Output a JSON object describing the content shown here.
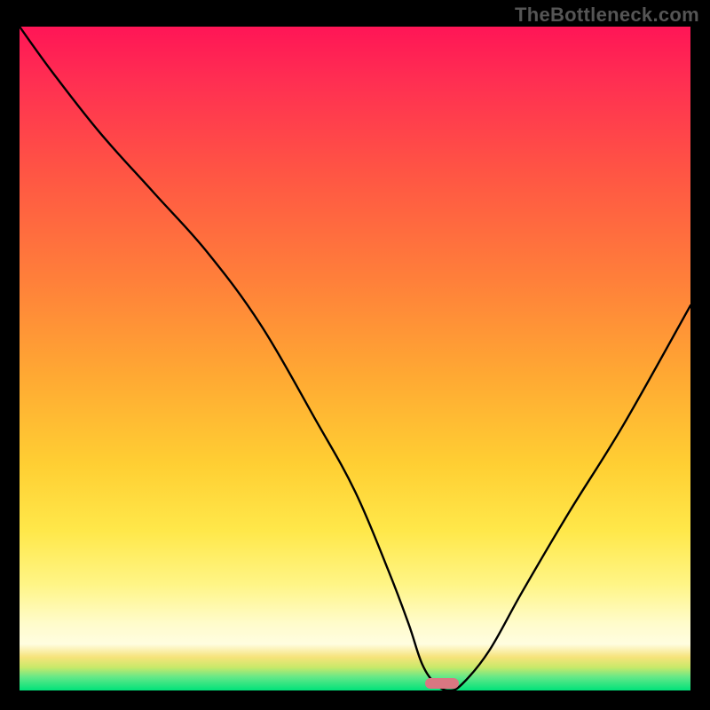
{
  "watermark": "TheBottleneck.com",
  "chart_data": {
    "type": "line",
    "title": "",
    "xlabel": "",
    "ylabel": "",
    "xlim": [
      0,
      100
    ],
    "ylim": [
      0,
      100
    ],
    "x": [
      0,
      5,
      12,
      20,
      28,
      36,
      44,
      50,
      55,
      58,
      60,
      62,
      64,
      66,
      70,
      75,
      82,
      90,
      100
    ],
    "values": [
      100,
      93,
      84,
      75,
      66,
      55,
      41,
      30,
      18,
      10,
      4,
      1,
      0,
      1,
      6,
      15,
      27,
      40,
      58
    ],
    "optimum_x_range": [
      60,
      66
    ],
    "background_gradient_stops": [
      {
        "pos": 0,
        "color": "#ff1556"
      },
      {
        "pos": 38,
        "color": "#ff7f3a"
      },
      {
        "pos": 66,
        "color": "#ffcf33"
      },
      {
        "pos": 93,
        "color": "#fffde0"
      },
      {
        "pos": 100,
        "color": "#00e27a"
      }
    ],
    "marker": {
      "x": 63,
      "width_pct": 5,
      "color": "#d97782"
    }
  }
}
